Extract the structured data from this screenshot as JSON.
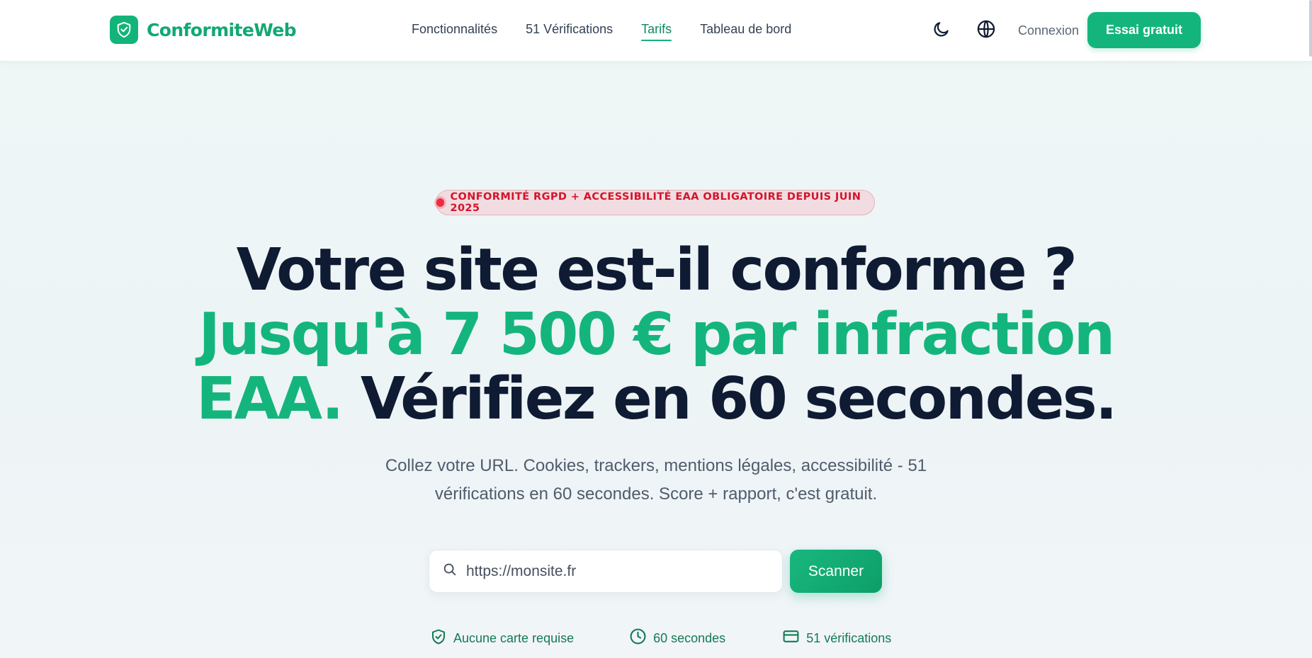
{
  "header": {
    "logo_text": "ConformiteWeb",
    "logo_icon": "shield-check-icon",
    "nav": [
      {
        "label": "Fonctionnalités",
        "active": false
      },
      {
        "label": "51 Vérifications",
        "active": false
      },
      {
        "label": "Tarifs",
        "active": true
      },
      {
        "label": "Tableau de bord",
        "active": false
      }
    ],
    "theme_icon": "moon-icon",
    "language_icon": "globe-icon",
    "login_label": "Connexion",
    "cta_label": "Essai gratuit"
  },
  "hero": {
    "badge_text": "CONFORMITÉ RGPD + ACCESSIBILITÉ EAA OBLIGATOIRE DEPUIS JUIN 2025",
    "headline_line1": "Votre site est-il conforme ?",
    "headline_line2": "Jusqu'à 7 500 € par infraction",
    "headline_line3_green": "EAA.",
    "headline_line3_dark": " Vérifiez en 60 secondes.",
    "subtitle_line1": "Collez votre URL. Cookies, trackers, mentions légales, accessibilité - 51",
    "subtitle_line2": "vérifications en 60 secondes. Score + rapport, c'est gratuit.",
    "search_placeholder": "https://monsite.fr",
    "scan_label": "Scanner",
    "features": [
      {
        "icon": "shield-check-icon",
        "label": "Aucune carte requise"
      },
      {
        "icon": "clock-icon",
        "label": "60 secondes"
      },
      {
        "icon": "credit-card-icon",
        "label": "51 vérifications"
      }
    ]
  },
  "colors": {
    "brand_green": "#14b57c",
    "heading_dark": "#0f1b33",
    "badge_red": "#d4142b"
  }
}
